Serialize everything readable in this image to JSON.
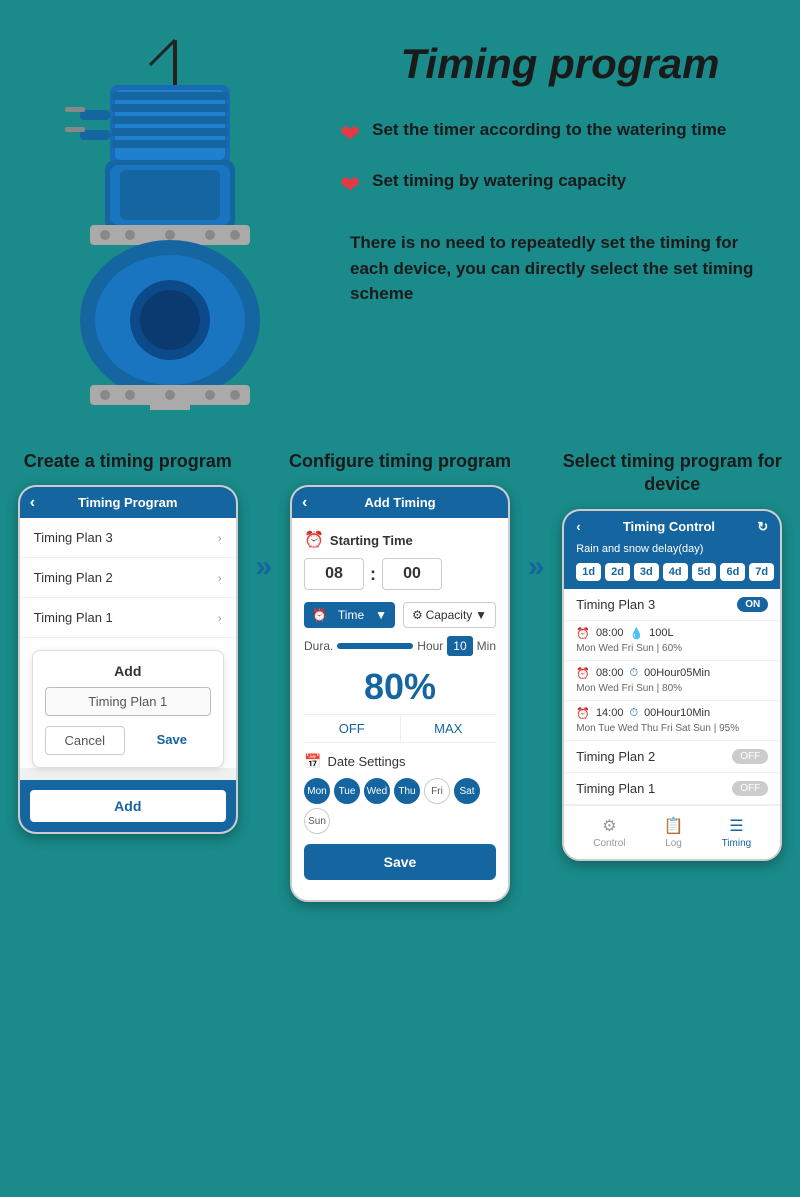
{
  "page": {
    "title": "Timing program",
    "background_color": "#1a8a8a"
  },
  "features": {
    "feature1": "Set the timer according to the watering time",
    "feature2": "Set timing by watering capacity",
    "description": "There is no need to repeatedly set the timing for each device, you can directly select the set timing scheme"
  },
  "columns": {
    "col1_label": "Create a timing program",
    "col2_label": "Configure timing program",
    "col3_label": "Select timing program for device"
  },
  "phone1": {
    "header": "Timing Program",
    "items": [
      "Timing Plan 3",
      "Timing Plan 2",
      "Timing Plan 1"
    ],
    "dialog_title": "Add",
    "dialog_input": "Timing Plan 1",
    "btn_cancel": "Cancel",
    "btn_save": "Save",
    "footer_btn": "Add"
  },
  "phone2": {
    "header": "Add Timing",
    "starting_time_label": "Starting Time",
    "hour": "08",
    "minute": "00",
    "mode1": "Time",
    "mode2": "Capacity",
    "dura_label": "Dura.",
    "dura_unit": "Hour",
    "dura_num": "10",
    "dura_min": "Min",
    "percent": "80%",
    "off_btn": "OFF",
    "max_btn": "MAX",
    "date_settings": "Date Settings",
    "days": [
      "Mon",
      "Tue",
      "Wed",
      "Thu",
      "Fri",
      "Sat",
      "Sun"
    ],
    "active_days": [
      1,
      1,
      1,
      1,
      0,
      1,
      0
    ],
    "save_btn": "Save"
  },
  "phone3": {
    "header": "Timing Control",
    "sub_header": "Rain and snow delay(day)",
    "delay_days": [
      "1d",
      "2d",
      "3d",
      "4d",
      "5d",
      "6d",
      "7d"
    ],
    "plan3_name": "Timing Plan 3",
    "plan3_toggle": "ON",
    "plan3_detail1_time": "08:00",
    "plan3_detail1_cap": "100L",
    "plan3_detail1_days": "Mon Wed Fri Sun | 60%",
    "plan3_detail2_time": "08:00",
    "plan3_detail2_dur": "00Hour05Min",
    "plan3_detail2_days": "Mon Wed Fri Sun | 80%",
    "plan3_detail3_time": "14:00",
    "plan3_detail3_dur": "00Hour10Min",
    "plan3_detail3_days": "Mon Tue Wed Thu Fri Sat Sun | 95%",
    "plan2_name": "Timing Plan 2",
    "plan2_toggle": "OFF",
    "plan1_name": "Timing Plan 1",
    "plan1_toggle": "OFF",
    "footer_control": "Control",
    "footer_log": "Log",
    "footer_timing": "Timing"
  }
}
